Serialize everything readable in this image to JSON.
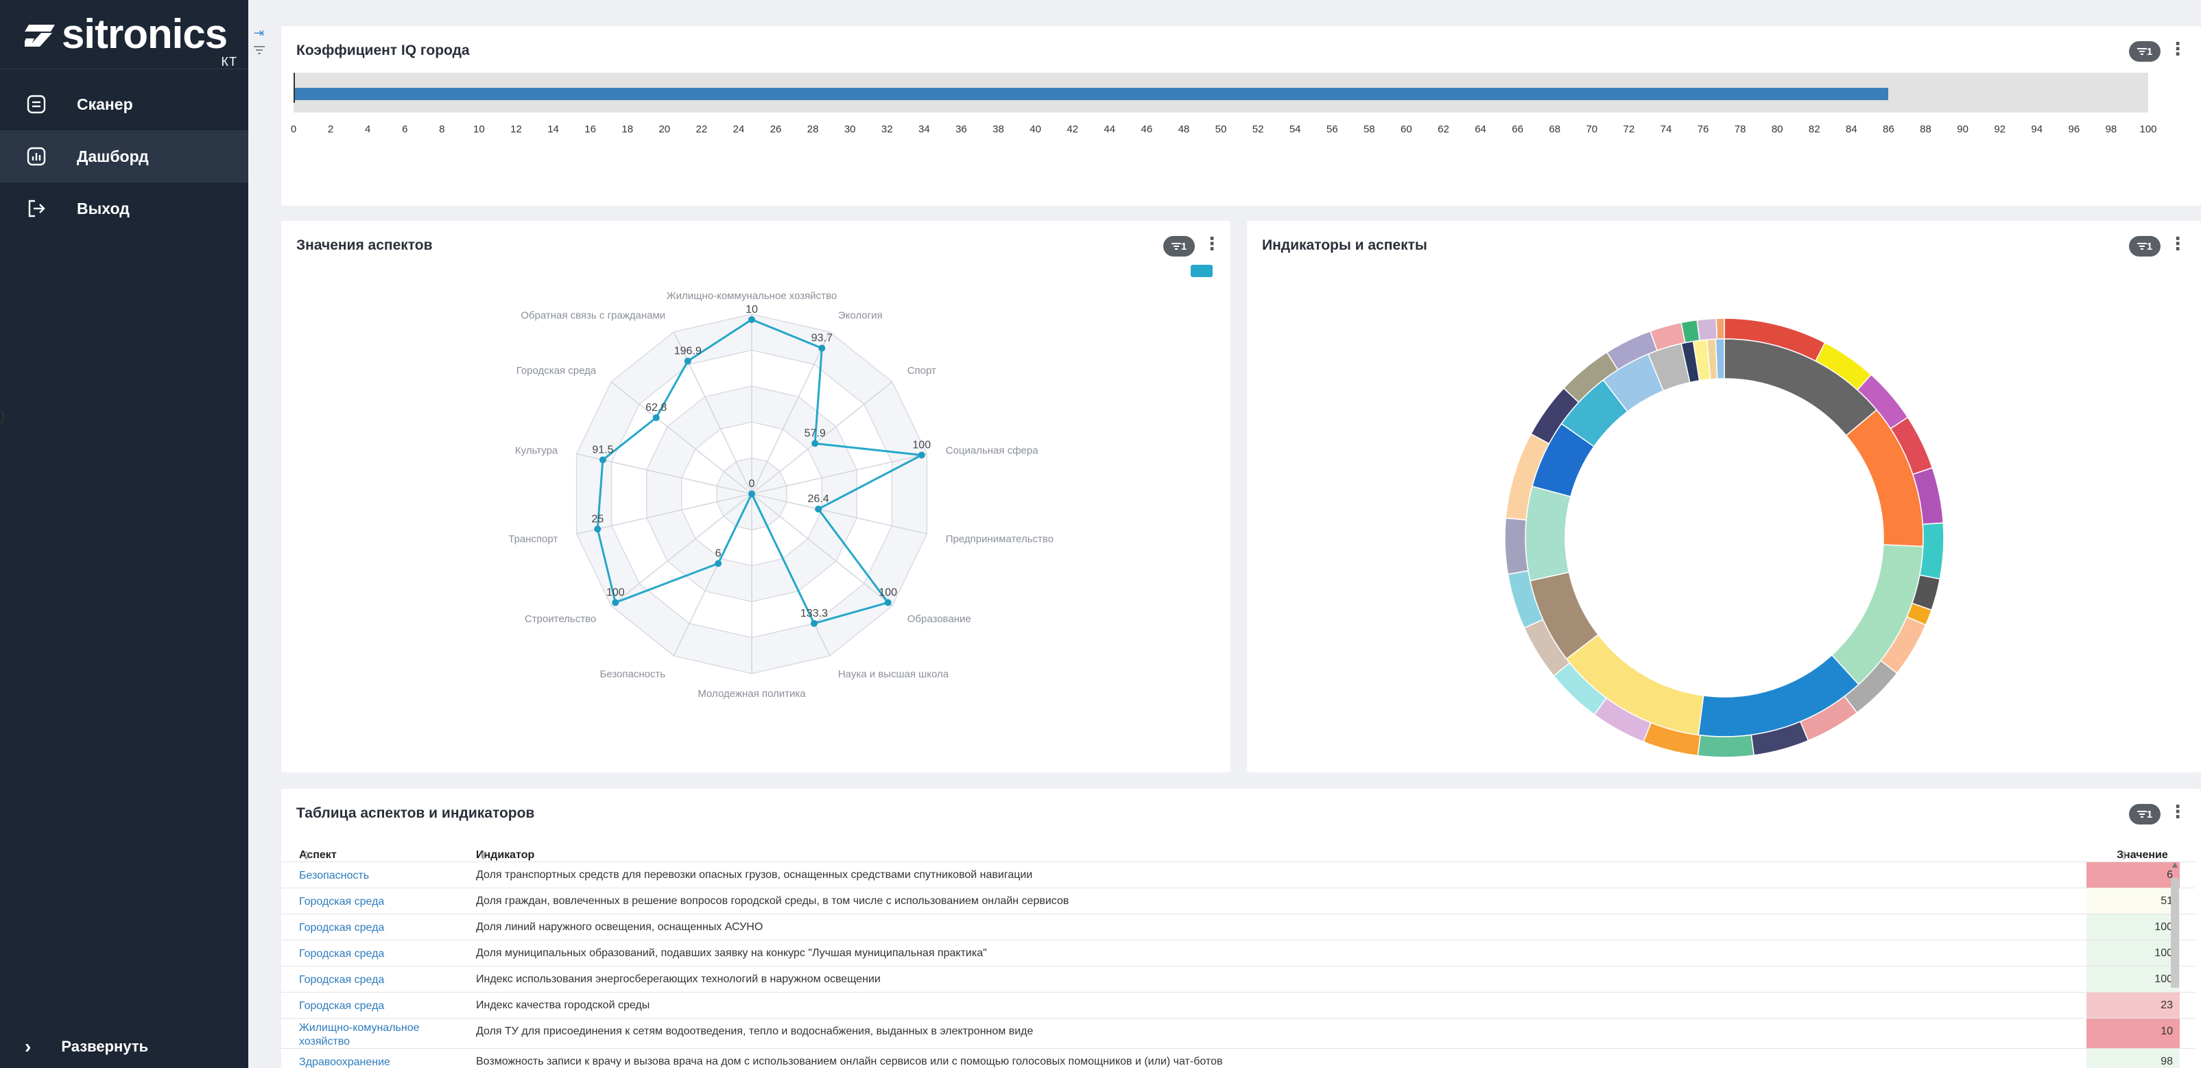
{
  "brand": {
    "name": "sitronics",
    "sub": "КТ"
  },
  "nav": {
    "items": [
      {
        "label": "Сканер",
        "icon": "scanner-icon"
      },
      {
        "label": "Дашборд",
        "icon": "dashboard-icon",
        "active": true
      },
      {
        "label": "Выход",
        "icon": "logout-icon"
      }
    ],
    "expand_label": "Развернуть"
  },
  "edge_glyph": ")",
  "iq_panel": {
    "title": "Коэффициент IQ города",
    "badge": "1",
    "value": 86,
    "axis_max": 100,
    "ticks": [
      "0",
      "2",
      "4",
      "6",
      "8",
      "10",
      "12",
      "14",
      "16",
      "18",
      "20",
      "22",
      "24",
      "26",
      "28",
      "30",
      "32",
      "34",
      "36",
      "38",
      "40",
      "42",
      "44",
      "46",
      "48",
      "50",
      "52",
      "54",
      "56",
      "58",
      "60",
      "62",
      "64",
      "66",
      "68",
      "70",
      "72",
      "74",
      "76",
      "78",
      "80",
      "82",
      "84",
      "86",
      "88",
      "90",
      "92",
      "94",
      "96",
      "98",
      "100"
    ],
    "bar_color": "#3a7fba"
  },
  "aspects_panel": {
    "title": "Значения аспектов",
    "badge": "1",
    "legend_color": "#25a8c9",
    "chart_data": {
      "type": "radar",
      "axes": [
        "Жилищно-коммунальное хозяйство",
        "Экология",
        "Спорт",
        "Социальная сфера",
        "Предпринимательство",
        "Образование",
        "Наука и высшая школа",
        "Молодежная политика",
        "Безопасность",
        "Строительство",
        "Транспорт",
        "Культура",
        "Городская среда",
        "Обратная связь с гражданами"
      ],
      "values": [
        10,
        93.7,
        57.9,
        100,
        26.4,
        100,
        133.3,
        0,
        6,
        100,
        25,
        91.5,
        62.8,
        196.9
      ],
      "plotted_radius_pct": [
        97,
        90,
        45,
        97,
        38,
        97,
        80,
        0,
        43,
        97,
        88,
        85,
        68,
        82
      ],
      "center_label": "0"
    }
  },
  "indicators_panel": {
    "title": "Индикаторы и аспекты",
    "badge": "1",
    "chart_data": {
      "type": "sunburst",
      "inner_ring": [
        {
          "value": 10,
          "color": "#666666"
        },
        {
          "value": 8.5,
          "color": "#fd7f3c"
        },
        {
          "value": 9,
          "color": "#a6dfbe"
        },
        {
          "value": 10,
          "color": "#1f87d0"
        },
        {
          "value": 9,
          "color": "#fbe27a"
        },
        {
          "value": 5,
          "color": "#a58c74"
        },
        {
          "value": 5.5,
          "color": "#a6dfcb"
        },
        {
          "value": 4,
          "color": "#1e6fcd"
        },
        {
          "value": 3.5,
          "color": "#3fb5d1"
        },
        {
          "value": 3,
          "color": "#9cc7e9"
        },
        {
          "value": 2,
          "color": "#b9b9b9"
        },
        {
          "value": 0.7,
          "color": "#2b3a61"
        },
        {
          "value": 0.8,
          "color": "#fdf18f"
        },
        {
          "value": 0.5,
          "color": "#f1d39a"
        },
        {
          "value": 0.5,
          "color": "#8ec0ea"
        }
      ],
      "outer_ring": [
        {
          "value": 6.5,
          "color": "#e14b3e"
        },
        {
          "value": 3.5,
          "color": "#f6ec12"
        },
        {
          "value": 3.5,
          "color": "#c05fc0"
        },
        {
          "value": 3.5,
          "color": "#e14b56"
        },
        {
          "value": 3.5,
          "color": "#b053b7"
        },
        {
          "value": 3.5,
          "color": "#3bc9c7"
        },
        {
          "value": 2,
          "color": "#555555"
        },
        {
          "value": 1,
          "color": "#f5a81e"
        },
        {
          "value": 3.5,
          "color": "#fbbf97"
        },
        {
          "value": 3.5,
          "color": "#aaaaaa"
        },
        {
          "value": 3.5,
          "color": "#ec9fa0"
        },
        {
          "value": 3.5,
          "color": "#42456e"
        },
        {
          "value": 3.5,
          "color": "#5fbf97"
        },
        {
          "value": 3.5,
          "color": "#f8a032"
        },
        {
          "value": 3.5,
          "color": "#dcb6df"
        },
        {
          "value": 3.5,
          "color": "#a2e5e6"
        },
        {
          "value": 3.5,
          "color": "#d3c2b4"
        },
        {
          "value": 3.5,
          "color": "#8bd2e1"
        },
        {
          "value": 3.5,
          "color": "#a3a2be"
        },
        {
          "value": 5.5,
          "color": "#fcd1a2"
        },
        {
          "value": 3.5,
          "color": "#413f6c"
        },
        {
          "value": 3.5,
          "color": "#a29f86"
        },
        {
          "value": 3,
          "color": "#a9a4c9"
        },
        {
          "value": 2,
          "color": "#f0a5a7"
        },
        {
          "value": 1,
          "color": "#3cb479"
        },
        {
          "value": 1.2,
          "color": "#d2b7d9"
        },
        {
          "value": 0.5,
          "color": "#f0a36a"
        }
      ]
    }
  },
  "table_panel": {
    "title": "Таблица аспектов и индикаторов",
    "badge": "1",
    "headers": {
      "aspect": "Аспект",
      "indicator": "Индикатор",
      "value": "Значение"
    },
    "rows": [
      {
        "aspect": "Безопасность",
        "indicator": "Доля транспортных средств для перевозки опасных грузов, оснащенных средствами спутниковой навигации",
        "value": "6",
        "color": "#f09fa6"
      },
      {
        "aspect": "Городская среда",
        "indicator": "Доля граждан, вовлеченных в решение вопросов городской среды, в том числе с использованием онлайн сервисов",
        "value": "51",
        "color": "#fbfcef"
      },
      {
        "aspect": "Городская среда",
        "indicator": "Доля линий наружного освещения, оснащенных АСУНО",
        "value": "100",
        "color": "#eaf5ec"
      },
      {
        "aspect": "Городская среда",
        "indicator": "Доля муниципальных образований, подавших заявку на конкурс \"Лучшая муниципальная практика\"",
        "value": "100",
        "color": "#eaf5ec"
      },
      {
        "aspect": "Городская среда",
        "indicator": "Индекс использования энергосберегающих технологий в наружном освещении",
        "value": "100",
        "color": "#eaf5ec"
      },
      {
        "aspect": "Городская среда",
        "indicator": "Индекс качества городской среды",
        "value": "23",
        "color": "#f4c6c9"
      },
      {
        "aspect": "Жилищно-комунальное хозяйство",
        "indicator": "Доля ТУ для присоединения к сетям водоотведения, тепло и водоснабжения, выданных в электронном виде",
        "value": "10",
        "color": "#f09fa6"
      },
      {
        "aspect": "Здравоохранение",
        "indicator": "Возможность записи к врачу и вызова врача на дом с использованием онлайн сервисов или с помощью голосовых помощников и (или) чат-ботов",
        "value": "98",
        "color": "#eaf5ec"
      }
    ]
  }
}
